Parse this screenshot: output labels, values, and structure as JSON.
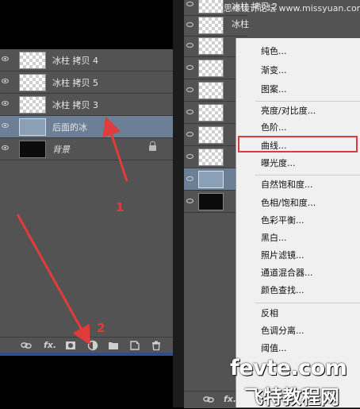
{
  "left_panel": {
    "layers": [
      {
        "name": "冰柱 拷贝 4",
        "thumb": "transparent"
      },
      {
        "name": "冰柱 拷贝 5",
        "thumb": "transparent"
      },
      {
        "name": "冰柱 拷贝 3",
        "thumb": "transparent"
      },
      {
        "name": "后面的冰",
        "thumb": "selected",
        "selected": true
      },
      {
        "name": "背景",
        "thumb": "black",
        "locked": true
      }
    ],
    "toolbar_icons": [
      "link-icon",
      "fx-icon",
      "mask-icon",
      "adjustment-icon",
      "folder-icon",
      "new-layer-icon",
      "trash-icon"
    ],
    "fx_label": "fx."
  },
  "right_panel": {
    "top_names": [
      "冰柱 拷贝 2",
      "冰柱"
    ],
    "toolbar_icons": [
      "link-icon",
      "fx-icon",
      "mask-icon",
      "adjustment-icon",
      "folder-icon",
      "new-layer-icon",
      "trash-icon"
    ],
    "fx_label": "fx."
  },
  "context_menu": {
    "groups": [
      [
        "纯色...",
        "渐变...",
        "图案..."
      ],
      [
        "亮度/对比度...",
        "色阶...",
        "曲线...",
        "曝光度..."
      ],
      [
        "自然饱和度...",
        "色相/饱和度...",
        "色彩平衡...",
        "黑白...",
        "照片滤镜...",
        "通道混合器...",
        "颜色查找..."
      ],
      [
        "反相",
        "色调分离...",
        "阈值..."
      ]
    ],
    "highlighted": "曲线..."
  },
  "annotations": {
    "label1": "1",
    "label2": "2",
    "color": "#e23b3b"
  },
  "watermarks": {
    "top": "思缘设计论坛  www.missyuan.com",
    "domain": "fevte.com",
    "cn": "飞特教程网"
  }
}
